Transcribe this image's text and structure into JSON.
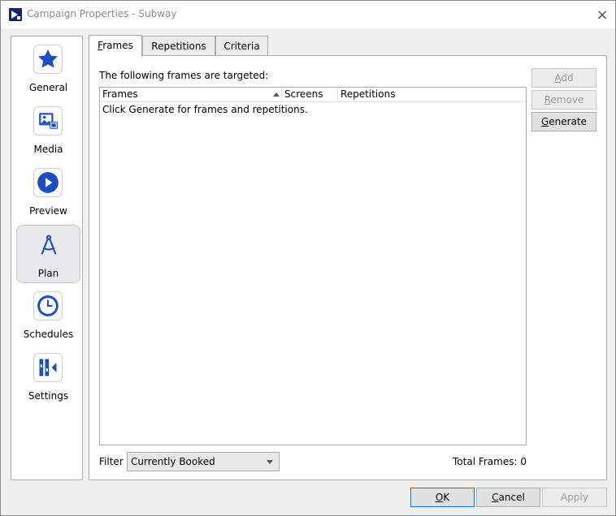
{
  "window": {
    "title": "Campaign Properties - Subway",
    "close_glyph": "×"
  },
  "sidebar": {
    "items": [
      {
        "label": "General",
        "icon": "star-icon"
      },
      {
        "label": "Media",
        "icon": "media-icon"
      },
      {
        "label": "Preview",
        "icon": "play-icon"
      },
      {
        "label": "Plan",
        "icon": "compass-icon",
        "active": true
      },
      {
        "label": "Schedules",
        "icon": "clock-icon"
      },
      {
        "label": "Settings",
        "icon": "settings-icon"
      }
    ]
  },
  "tabs": [
    {
      "label_u": "F",
      "label_rest": "rames",
      "active": true
    },
    {
      "label": "Repetitions"
    },
    {
      "label": "Criteria"
    }
  ],
  "frames": {
    "header_text": "The following frames are targeted:",
    "columns": [
      "Frames",
      "Screens",
      "Repetitions"
    ],
    "empty_message": "Click Generate for frames and repetitions."
  },
  "side_buttons": {
    "add": {
      "u": "A",
      "rest": "dd"
    },
    "remove": {
      "u": "R",
      "rest": "emove"
    },
    "generate": {
      "u": "G",
      "rest": "enerate"
    }
  },
  "filter": {
    "label": "Filter",
    "selected": "Currently Booked"
  },
  "total": {
    "label": "Total Frames:",
    "value": "0"
  },
  "footer": {
    "ok": {
      "u": "O",
      "rest": "K"
    },
    "cancel": {
      "u": "C",
      "rest": "ancel"
    },
    "apply": {
      "label": "Apply"
    }
  },
  "colors": {
    "accent": "#1a4fc4",
    "focus": "#0078d7",
    "disabled_text": "#9d9d9d"
  }
}
